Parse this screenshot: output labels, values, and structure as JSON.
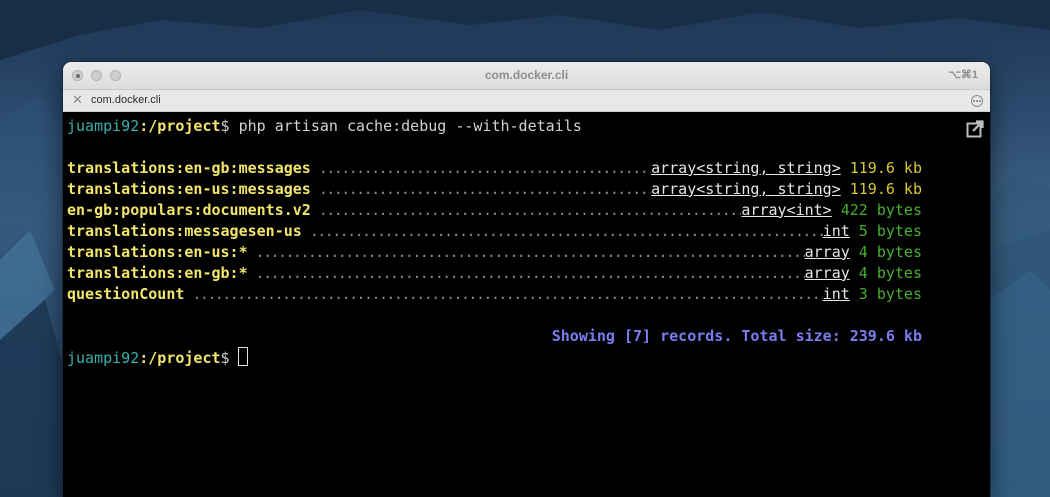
{
  "window": {
    "title": "com.docker.cli",
    "shortcut": "⌥⌘1",
    "tab_label": "com.docker.cli",
    "tab_close": "✕"
  },
  "terminal": {
    "prompt_user": "juampi92",
    "prompt_path": ":/project",
    "prompt_symbol": "$",
    "command": " php artisan cache:debug --with-details",
    "rows": [
      {
        "key": "translations:en-gb:messages",
        "type": "array<string, string>",
        "size": "119.6 kb",
        "size_color": "#d8c832"
      },
      {
        "key": "translations:en-us:messages",
        "type": "array<string, string>",
        "size": "119.6 kb",
        "size_color": "#d8c832"
      },
      {
        "key": "en-gb:populars:documents.v2",
        "type": "array<int>",
        "size": "422 bytes",
        "size_color": "#45b02f"
      },
      {
        "key": "translations:messagesen-us",
        "type": "int",
        "size": "5 bytes",
        "size_color": "#45b02f"
      },
      {
        "key": "translations:en-us:*",
        "type": "array",
        "size": "4 bytes",
        "size_color": "#45b02f"
      },
      {
        "key": "translations:en-gb:*",
        "type": "array",
        "size": "4 bytes",
        "size_color": "#45b02f"
      },
      {
        "key": "questionCount",
        "type": "int",
        "size": "3 bytes",
        "size_color": "#45b02f"
      }
    ],
    "summary": "Showing [7] records. Total size: 239.6 kb"
  },
  "icons": {
    "popout": "popout-icon",
    "tab_menu": "more-icon"
  }
}
